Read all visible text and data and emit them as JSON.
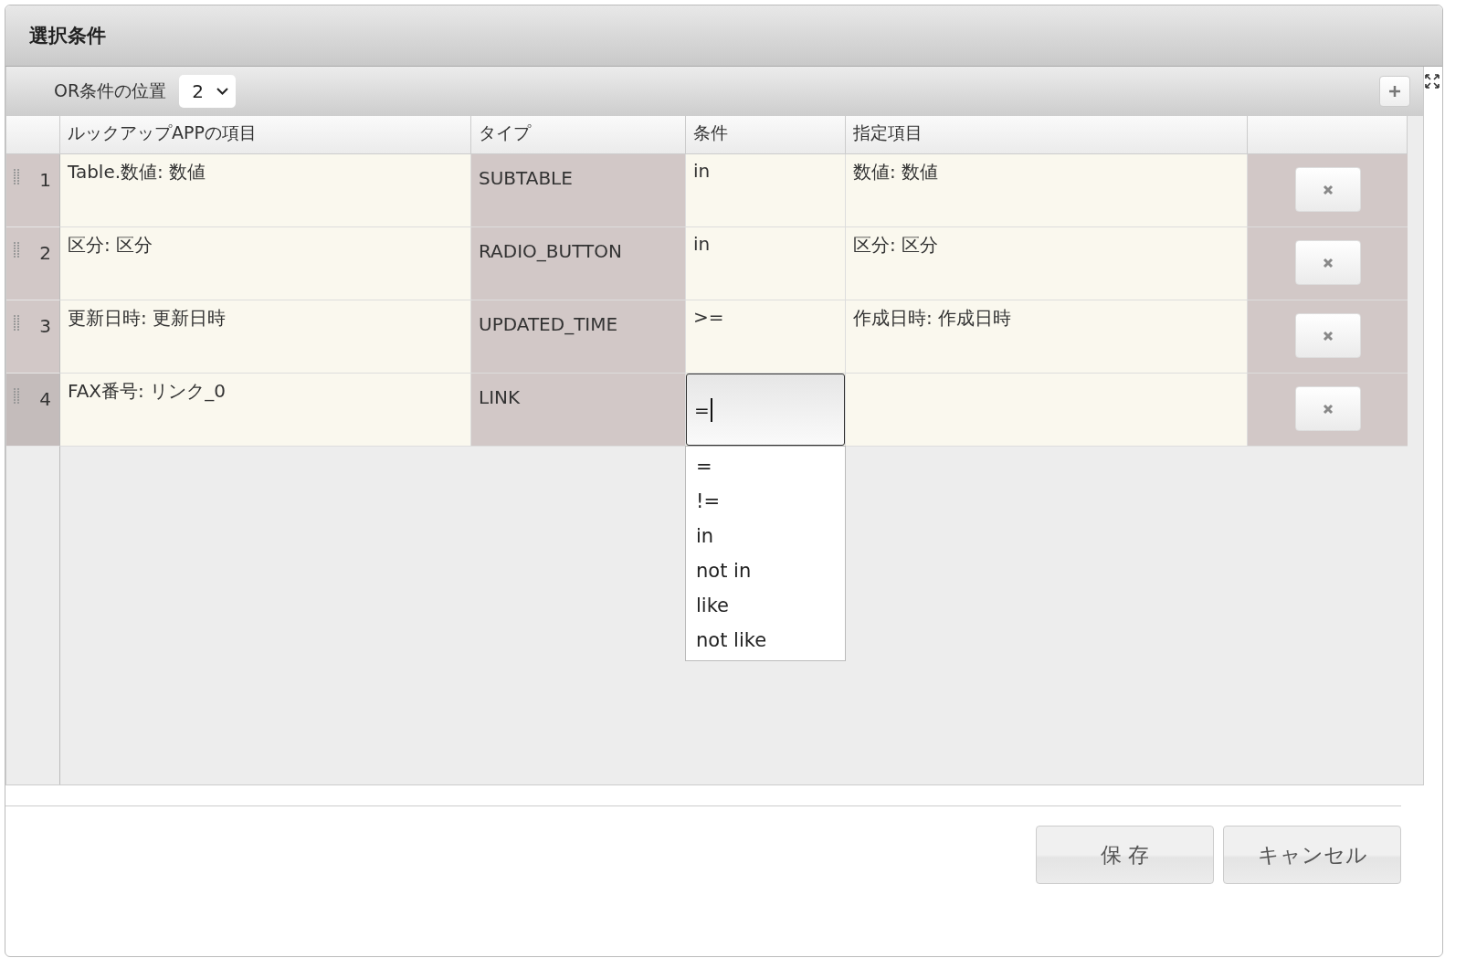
{
  "dialog": {
    "title": "選択条件"
  },
  "toolbar": {
    "label": "OR条件の位置",
    "select_value": "2"
  },
  "table": {
    "columns": [
      "ルックアップAPPの項目",
      "タイプ",
      "条件",
      "指定項目"
    ],
    "rows": [
      {
        "number": "1",
        "selected": false,
        "item": "Table.数値: 数値",
        "type": "SUBTABLE",
        "condition": "in",
        "editing": false,
        "target": "数値: 数値"
      },
      {
        "number": "2",
        "selected": false,
        "item": "区分: 区分",
        "type": "RADIO_BUTTON",
        "condition": "in",
        "editing": false,
        "target": "区分: 区分"
      },
      {
        "number": "3",
        "selected": false,
        "item": "更新日時: 更新日時",
        "type": "UPDATED_TIME",
        "condition": ">=",
        "editing": false,
        "target": "作成日時: 作成日時"
      },
      {
        "number": "4",
        "selected": true,
        "item": "FAX番号: リンク_0",
        "type": "LINK",
        "condition": "=",
        "editing": true,
        "target": ""
      }
    ],
    "dropdown_options": [
      "=",
      "!=",
      "in",
      "not in",
      "like",
      "not like"
    ]
  },
  "buttons": [
    "保 存",
    "キャンセル"
  ]
}
